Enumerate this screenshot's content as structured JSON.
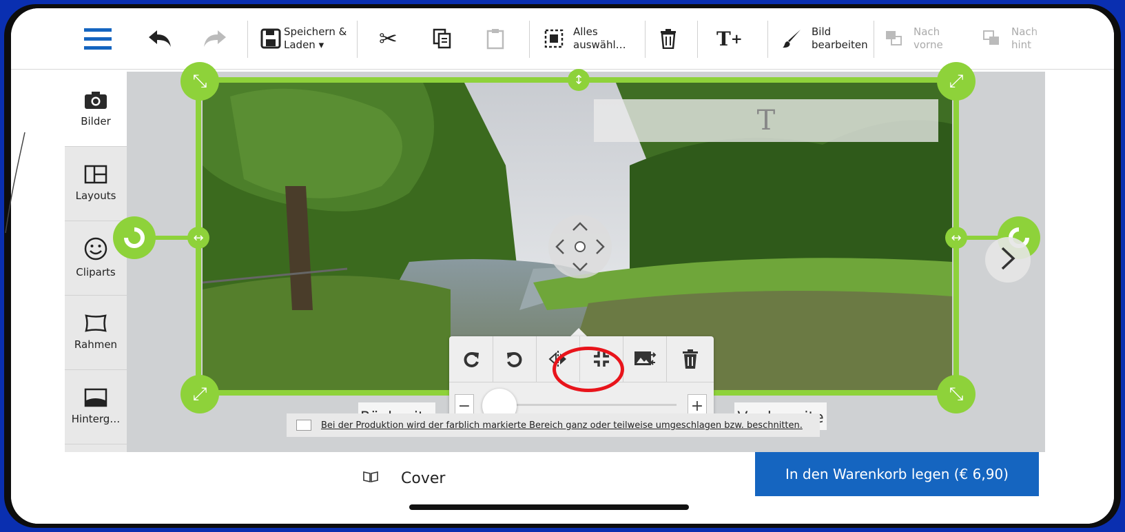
{
  "toolbar": {
    "menu_icon": "hamburger-menu-icon",
    "save_load_line1": "Speichern &",
    "save_load_line2": "Laden ▾",
    "select_all_line1": "Alles",
    "select_all_line2": "auswähl…",
    "edit_image_line1": "Bild",
    "edit_image_line2": "bearbeiten",
    "bring_forward_line1": "Nach",
    "bring_forward_line2": "vorne",
    "send_back_line1": "Nach",
    "send_back_line2": "hint"
  },
  "sidebar": {
    "items": [
      {
        "label": "Bilder",
        "icon": "camera-icon"
      },
      {
        "label": "Layouts",
        "icon": "layout-icon"
      },
      {
        "label": "Cliparts",
        "icon": "smiley-icon"
      },
      {
        "label": "Rahmen",
        "icon": "frame-icon"
      },
      {
        "label": "Hinterg…",
        "icon": "background-icon"
      }
    ]
  },
  "canvas": {
    "text_placeholder": "T",
    "back_label": "Rückseite",
    "front_label": "Vorderseite",
    "notice": "Bei der Produktion wird der farblich markierte Bereich ganz oder teilweise umgeschlagen bzw. beschnitten.",
    "zoom_minus": "−",
    "zoom_plus": "+"
  },
  "bottom": {
    "cover_label": "Cover",
    "cart_button": "In den Warenkorb legen (€ 6,90)"
  },
  "colors": {
    "accent_green": "#8ed23a",
    "cart_blue": "#1565c0",
    "highlight_red": "#e8141b"
  }
}
